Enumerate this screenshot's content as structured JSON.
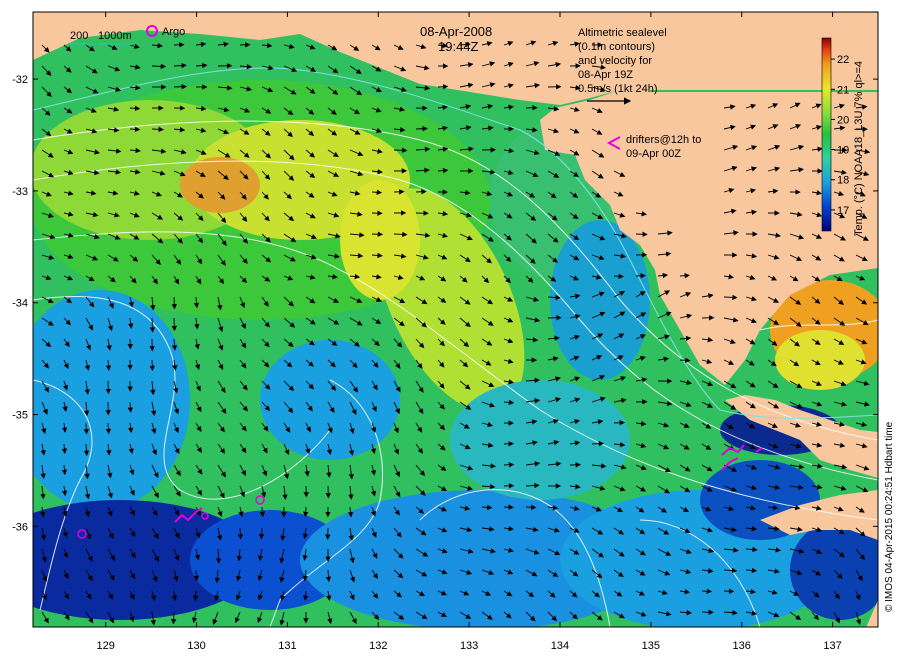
{
  "map": {
    "date": "08-Apr-2008",
    "time": "19:44Z",
    "lon_ticks": [
      "129",
      "130",
      "131",
      "132",
      "133",
      "134",
      "135",
      "136",
      "137"
    ],
    "lat_ticks": [
      "-32",
      "-33",
      "-34",
      "-35",
      "-36"
    ],
    "lon_range": [
      128.2,
      137.5
    ],
    "lat_range": [
      -36.9,
      -31.4
    ]
  },
  "legend": {
    "depth_label_200": "200",
    "depth_label_1000": "1000m",
    "argo_label": "Argo",
    "sealevel_lines": [
      "Altimetric sealevel",
      "(0.1m contours)",
      "and velocity for",
      "08-Apr 19Z"
    ],
    "velocity_scale": "0.5m/s (1kt 24h)",
    "drifters_lines": [
      "drifters@12h to",
      "09-Apr 00Z"
    ]
  },
  "colorbar": {
    "title": "Temp. (°C) NOAA18_L3U 7% ql>=4",
    "ticks": [
      "22",
      "21",
      "20",
      "19",
      "18",
      "17"
    ],
    "range": [
      16.3,
      22.7
    ],
    "colors": [
      "#00007a",
      "#0040d0",
      "#1a9fe0",
      "#2fd0a0",
      "#25c040",
      "#8ee03a",
      "#e6e62a",
      "#f0a020",
      "#e04010",
      "#8a0000"
    ]
  },
  "credit": "© IMOS 04-Apr-2015 00:24:51 Hdbart time",
  "colors": {
    "land": "#f8c79e",
    "drifter": "#e000e0",
    "contour": "#ffffff",
    "shelf_200": "#7fe0e0"
  }
}
